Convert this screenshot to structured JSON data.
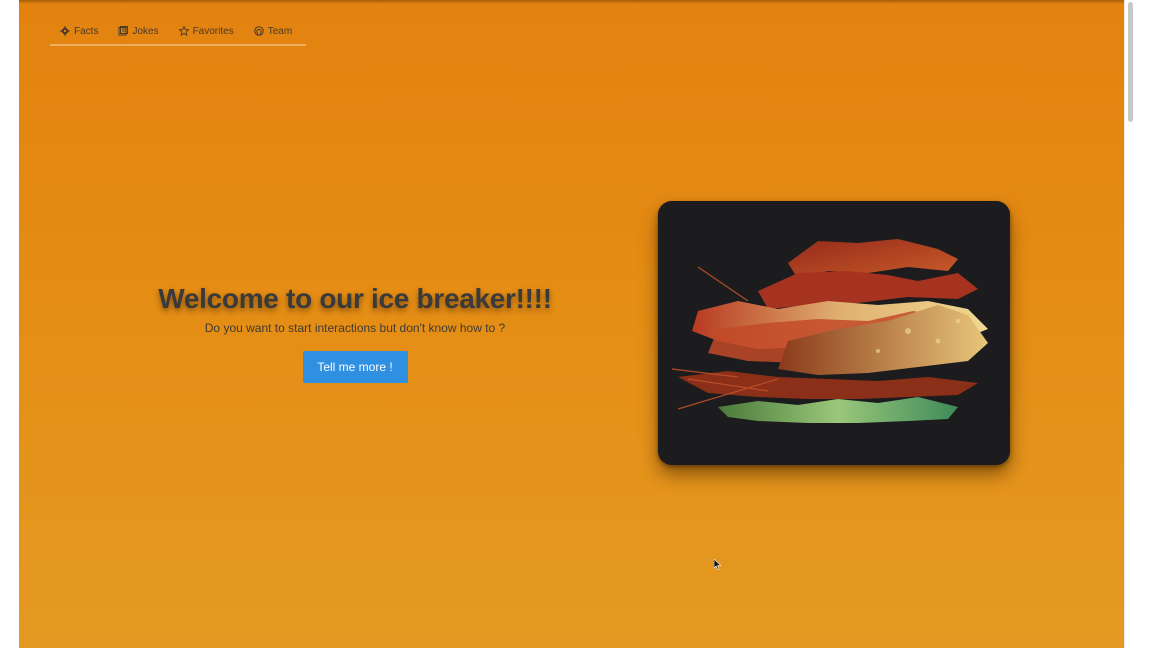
{
  "nav": {
    "items": [
      {
        "label": "Facts",
        "icon": "gear-icon"
      },
      {
        "label": "Jokes",
        "icon": "book-icon"
      },
      {
        "label": "Favorites",
        "icon": "star-icon"
      },
      {
        "label": "Team",
        "icon": "github-icon"
      }
    ]
  },
  "hero": {
    "title": "Welcome to our ice breaker!!!!",
    "subtitle": "Do you want to start interactions but don't know how to ?",
    "cta_label": "Tell me more !"
  },
  "image": {
    "description_icon": "abstract-art-image"
  },
  "colors": {
    "background_top": "#e3820f",
    "background_bottom": "#e49a22",
    "cta": "#2f8fe0",
    "title": "#3a3a3a",
    "card": "#1c1c1e"
  }
}
